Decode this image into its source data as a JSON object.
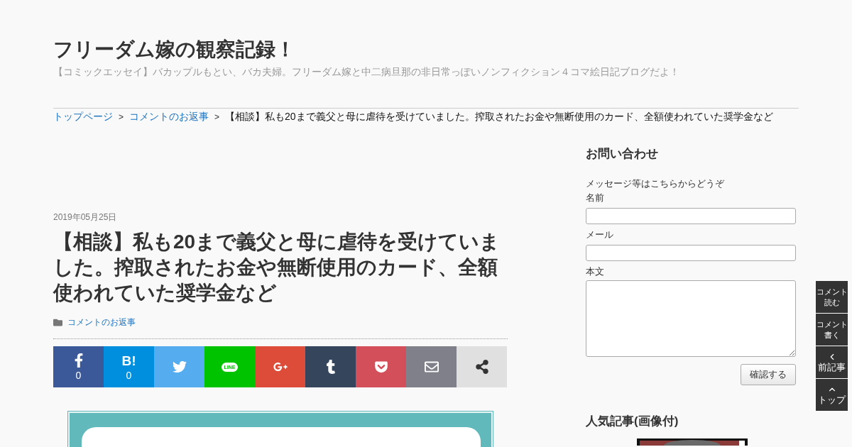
{
  "site": {
    "title": "フリーダム嫁の観察記録！",
    "tagline": "【コミックエッセイ】バカップルもとい、バカ夫婦。フリーダム嫁と中二病旦那の非日常っぽいノンフィクション４コマ絵日記ブログだよ！"
  },
  "breadcrumb": [
    {
      "label": "トップページ",
      "kind": "link"
    },
    {
      "label": "コメントのお返事",
      "kind": "link"
    },
    {
      "label": "【相談】私も20まで義父と母に虐待を受けていました。搾取されたお金や無断使用のカード、全額使われていた奨学金など",
      "kind": "current"
    }
  ],
  "breadcrumb_separator": ">",
  "post": {
    "date": "2019年05月25日",
    "title": "【相談】私も20まで義父と母に虐待を受けていました。搾取されたお金や無断使用のカード、全額使われていた奨学金など",
    "category": "コメントのお返事"
  },
  "share_buttons": [
    {
      "kind": "facebook",
      "count": "0"
    },
    {
      "kind": "hatena",
      "label": "B!",
      "count": "0"
    },
    {
      "kind": "twitter"
    },
    {
      "kind": "line",
      "label": "LINE"
    },
    {
      "kind": "googleplus"
    },
    {
      "kind": "tumblr"
    },
    {
      "kind": "pocket"
    },
    {
      "kind": "mail"
    },
    {
      "kind": "share"
    }
  ],
  "sidebar": {
    "contact": {
      "heading": "お問い合わせ",
      "intro": "メッセージ等はこちらからどうぞ",
      "fields": [
        {
          "label": "名前",
          "kind": "input"
        },
        {
          "label": "メール",
          "kind": "input"
        },
        {
          "label": "本文",
          "kind": "textarea"
        }
      ],
      "submit": "確認する"
    },
    "popular": {
      "heading": "人気記事(画像付)"
    }
  },
  "floating_buttons": [
    {
      "label": "コメント読む",
      "kind": "text"
    },
    {
      "label": "コメント書く",
      "kind": "text"
    },
    {
      "label": "前記事",
      "kind": "prev"
    },
    {
      "label": "トップ",
      "kind": "top"
    }
  ]
}
